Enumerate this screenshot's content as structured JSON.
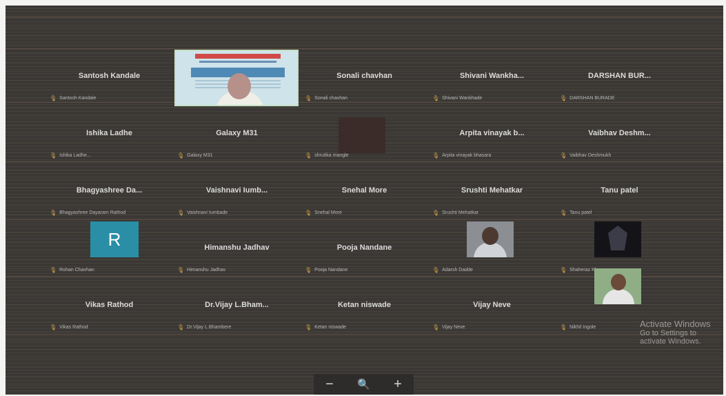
{
  "grid": {
    "tiles": [
      {
        "name": "Santosh Kandale",
        "label": "Santosh Kandale"
      },
      {
        "name": "",
        "label": ""
      },
      {
        "name": "Sonali chavhan",
        "label": "Sonali chavhan"
      },
      {
        "name": "Shivani Wankha...",
        "label": "Shivani Wankhade"
      },
      {
        "name": "DARSHAN BUR...",
        "label": "DARSHAN BURADE"
      },
      {
        "name": "Ishika Ladhe",
        "label": "Ishika Ladhe..."
      },
      {
        "name": "Galaxy M31",
        "label": "Galaxy M31"
      },
      {
        "name": "",
        "label": "shrutika mangle"
      },
      {
        "name": "Arpita vinayak b...",
        "label": "Arpita vinayak bhasara"
      },
      {
        "name": "Vaibhav Deshm...",
        "label": "Vaibhav Deshmukh"
      },
      {
        "name": "Bhagyashree Da...",
        "label": "Bhagyashree Dayaram Rathod"
      },
      {
        "name": "Vaishnavi Iumb...",
        "label": "Vaishnavi Iumbade"
      },
      {
        "name": "Snehal More",
        "label": "Snehal More"
      },
      {
        "name": "Srushti Mehatkar",
        "label": "Srushti Mehatkar"
      },
      {
        "name": "Tanu patel",
        "label": "Tanu patel"
      },
      {
        "name": "",
        "label": "Rohan Chavhan",
        "avatar_letter": "R"
      },
      {
        "name": "Himanshu Jadhav",
        "label": "Himanshu Jadhav"
      },
      {
        "name": "Pooja Nandane",
        "label": "Pooja Nandane"
      },
      {
        "name": "",
        "label": "Adarsh Dadde"
      },
      {
        "name": "",
        "label": "Shaheraz Khan"
      },
      {
        "name": "Vikas Rathod",
        "label": "Vikas Rathod"
      },
      {
        "name": "Dr.Vijay L.Bham...",
        "label": "Dr.Vijay L.Bhambere"
      },
      {
        "name": "Ketan niswade",
        "label": "Ketan niswade"
      },
      {
        "name": "Vijay Neve",
        "label": "Vijay Neve"
      },
      {
        "name": "",
        "label": "Nikhil Ingole"
      }
    ]
  },
  "watermark": {
    "title": "Activate Windows",
    "subtitle": "Go to Settings to activate Windows."
  },
  "zoom": {
    "minus": "−",
    "search_icon": "search-icon",
    "plus": "+"
  },
  "colors": {
    "background": "#3a3734",
    "avatar": "#2a8fa6",
    "mic": "#d8a64a"
  }
}
